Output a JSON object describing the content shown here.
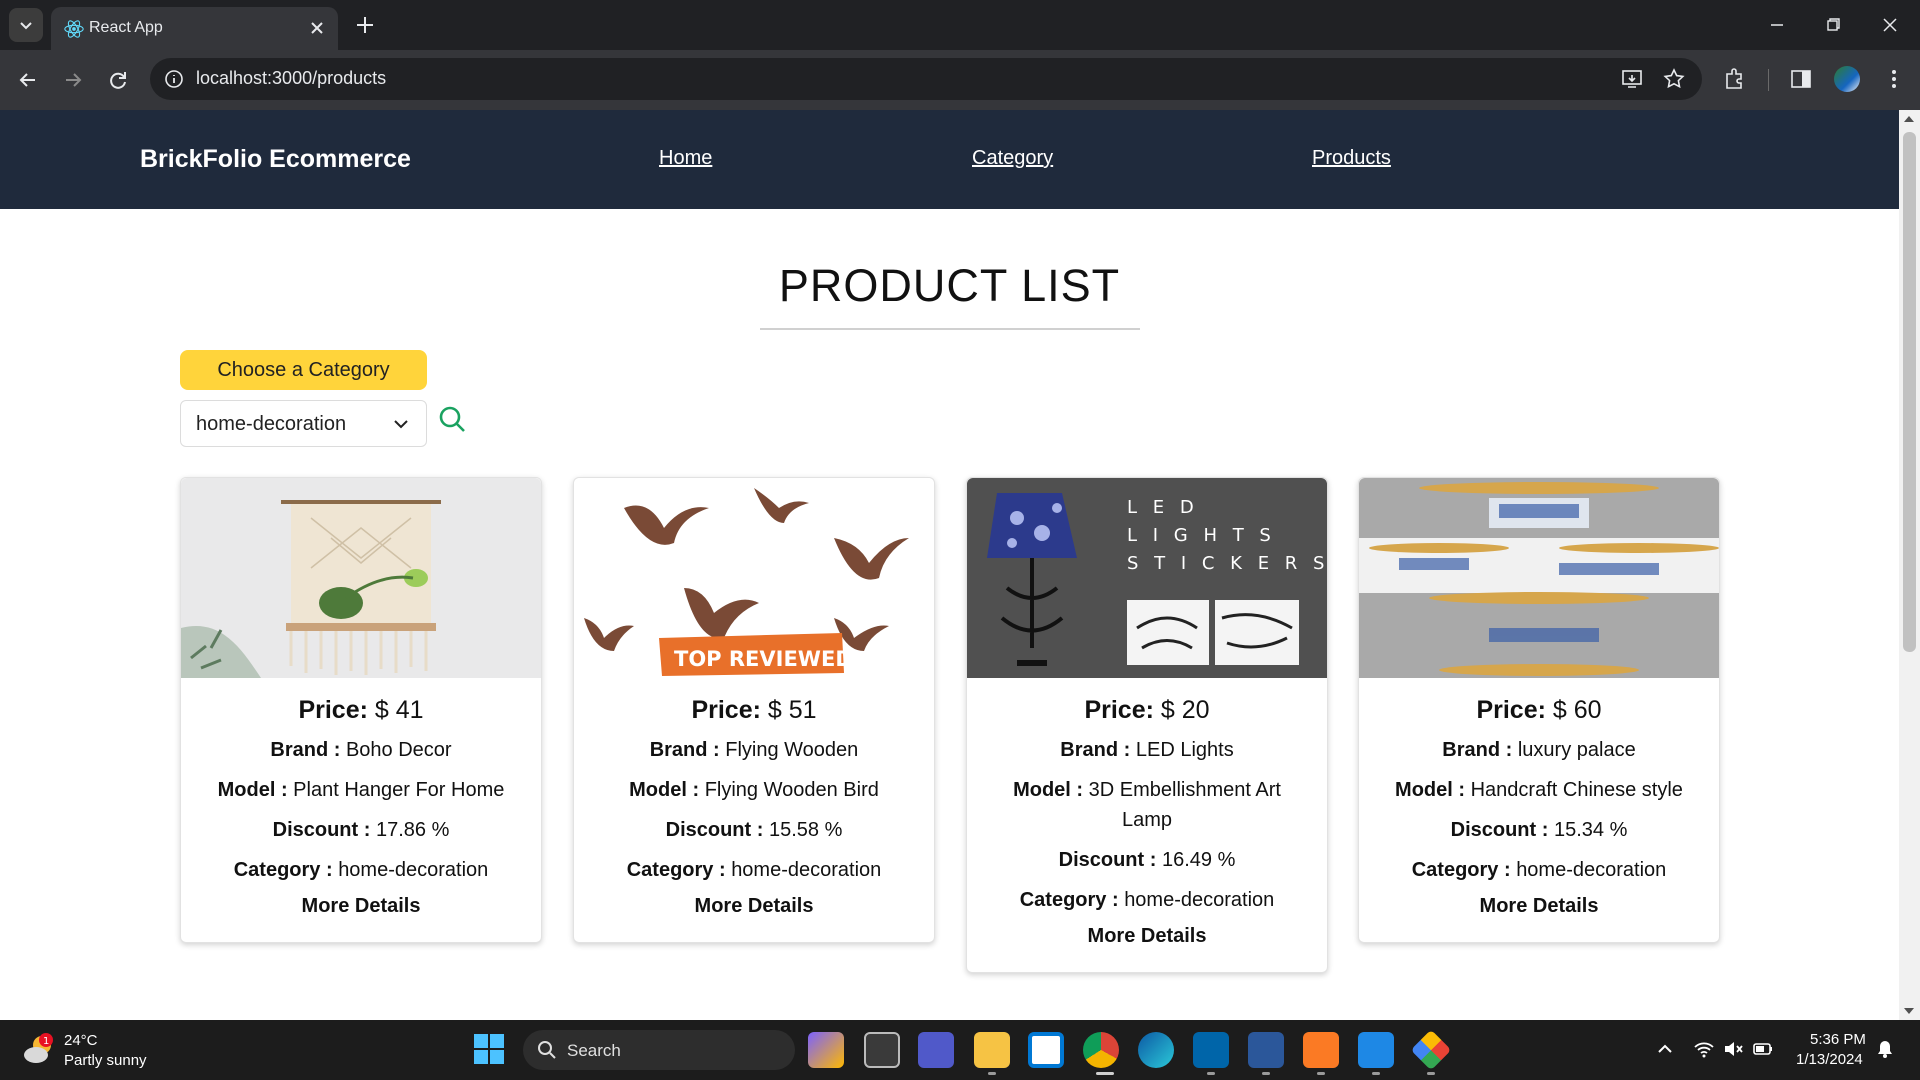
{
  "browser": {
    "tab_title": "React App",
    "url": "localhost:3000/products"
  },
  "site": {
    "brand": "BrickFolio Ecommerce",
    "nav": [
      "Home",
      "Category",
      "Products"
    ]
  },
  "page": {
    "heading": "PRODUCT LIST",
    "choose_label": "Choose a Category",
    "selected_category": "home-decoration"
  },
  "labels": {
    "price": "Price:",
    "brand": "Brand :",
    "model": "Model :",
    "discount": "Discount :",
    "category": "Category :",
    "more": "More Details"
  },
  "products": [
    {
      "price": "$ 41",
      "brand": "Boho Decor",
      "model": "Plant Hanger For Home",
      "discount": "17.86 %",
      "category": "home-decoration"
    },
    {
      "price": "$ 51",
      "brand": "Flying Wooden",
      "model": "Flying Wooden Bird",
      "discount": "15.58 %",
      "category": "home-decoration",
      "image_text": "TOP REVIEWED"
    },
    {
      "price": "$ 20",
      "brand": "LED Lights",
      "model": "3D Embellishment Art Lamp",
      "discount": "16.49 %",
      "category": "home-decoration",
      "image_text": "L E D\nL I G H T S\nS T I C K E R S"
    },
    {
      "price": "$ 60",
      "brand": "luxury palace",
      "model": "Handcraft Chinese style",
      "discount": "15.34 %",
      "category": "home-decoration"
    }
  ],
  "taskbar": {
    "temp": "24°C",
    "weather": "Partly sunny",
    "weather_badge": "1",
    "search": "Search",
    "time": "5:36 PM",
    "date": "1/13/2024"
  },
  "colors": {
    "nav_bg": "#1f2a3c",
    "accent_yellow": "#ffd43b",
    "search_green": "#1aa260"
  }
}
